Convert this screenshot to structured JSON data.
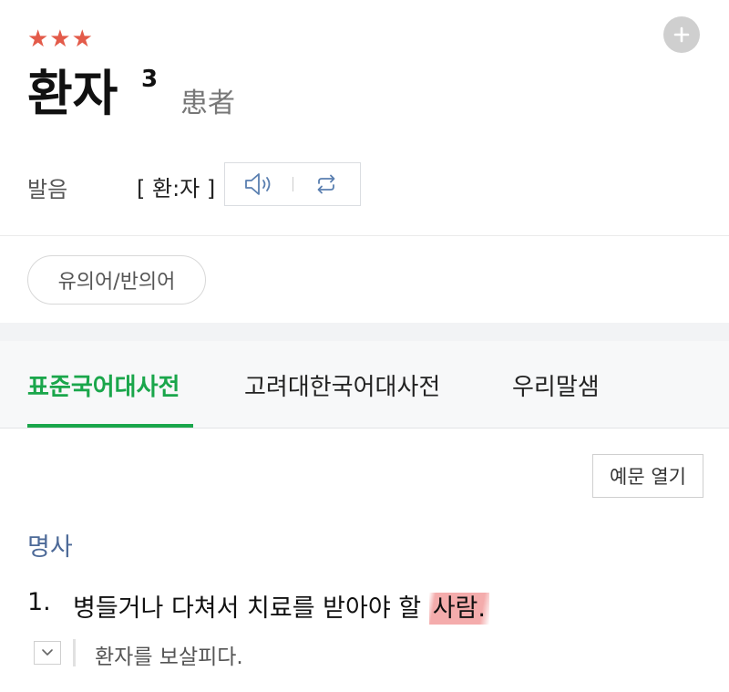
{
  "entry": {
    "stars": "★★★",
    "star_color": "#e35b4a",
    "headword": "환자",
    "homonym_number": "3",
    "hanja": "患者"
  },
  "pronunciation": {
    "label": "발음",
    "text": "[ 환:자 ]",
    "play_icon": "speaker-icon",
    "repeat_icon": "repeat-icon"
  },
  "synonym_button": "유의어/반의어",
  "tabs": [
    {
      "label": "표준국어대사전",
      "active": true
    },
    {
      "label": "고려대한국어대사전",
      "active": false
    },
    {
      "label": "우리말샘",
      "active": false
    }
  ],
  "accent_color": "#1aa64b",
  "examples_button": "예문 열기",
  "part_of_speech": "명사",
  "definition": {
    "number": "1.",
    "text_before": "병들거나 다쳐서 치료를 받아야 할 ",
    "highlighted": "사람",
    "text_after": "."
  },
  "example": {
    "text": "환자를 보살피다.",
    "toggle_icon": "chevron-down-icon"
  }
}
